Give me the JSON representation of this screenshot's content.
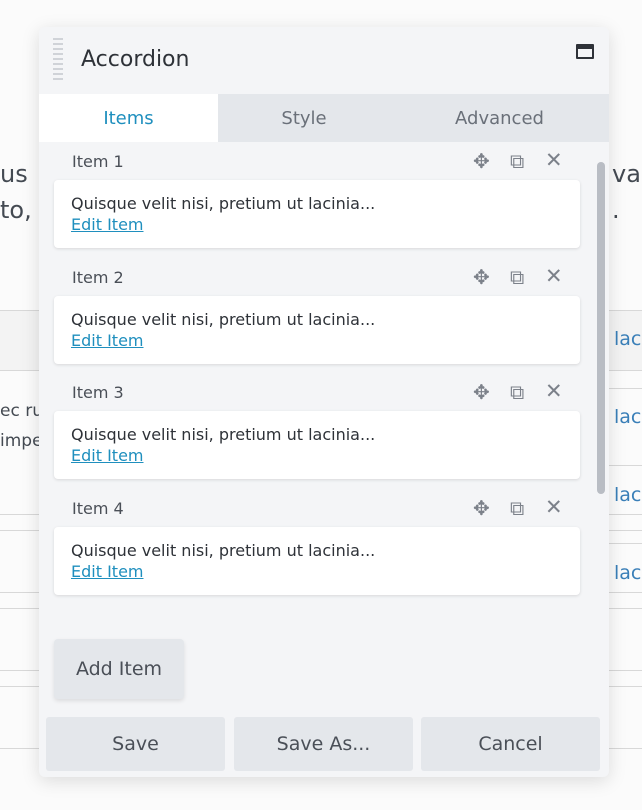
{
  "background": {
    "left_lines": [
      "us",
      "to,"
    ],
    "right_lines": [
      "val",
      "."
    ],
    "small_lines": [
      "ec ru",
      "impe"
    ],
    "links": [
      "lac",
      "lac",
      "lac",
      "lac"
    ]
  },
  "panel": {
    "title": "Accordion",
    "tabs": [
      {
        "label": "Items",
        "active": true
      },
      {
        "label": "Style",
        "active": false
      },
      {
        "label": "Advanced",
        "active": false
      }
    ],
    "items": [
      {
        "label": "Item 1",
        "preview": "Quisque velit nisi, pretium ut lacinia...",
        "edit_label": "Edit Item"
      },
      {
        "label": "Item 2",
        "preview": "Quisque velit nisi, pretium ut lacinia...",
        "edit_label": "Edit Item"
      },
      {
        "label": "Item 3",
        "preview": "Quisque velit nisi, pretium ut lacinia...",
        "edit_label": "Edit Item"
      },
      {
        "label": "Item 4",
        "preview": "Quisque velit nisi, pretium ut lacinia...",
        "edit_label": "Edit Item"
      }
    ],
    "item_icons": [
      "move-icon",
      "copy-icon",
      "close-icon"
    ],
    "add_button": "Add Item",
    "footer": {
      "save": "Save",
      "save_as": "Save As...",
      "cancel": "Cancel"
    }
  },
  "colors": {
    "accent": "#1f8fbe",
    "panel_bg": "#f4f5f7",
    "tab_bg": "#e4e7eb"
  }
}
